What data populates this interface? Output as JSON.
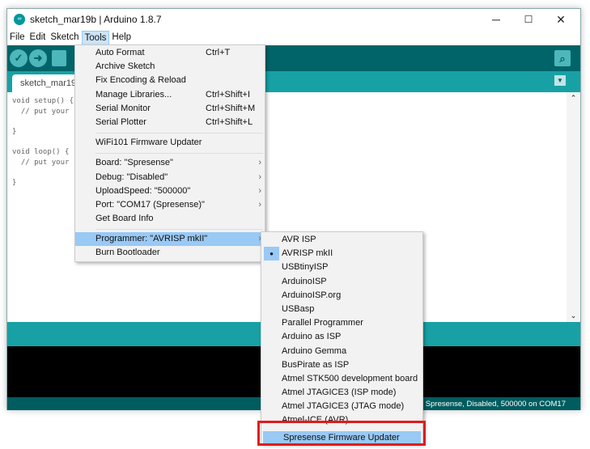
{
  "window": {
    "title": "sketch_mar19b | Arduino 1.8.7",
    "icon": "arduino-logo-icon",
    "controls": {
      "minimize": "─",
      "maximize": "☐",
      "close": "✕"
    }
  },
  "menubar": [
    "File",
    "Edit",
    "Sketch",
    "Tools",
    "Help"
  ],
  "toolbar": {
    "verify": "✓",
    "upload": "➜",
    "new": "new-icon",
    "serial_monitor": "magnifier-icon"
  },
  "tab": {
    "label": "sketch_mar19"
  },
  "editor": {
    "lines": [
      "void setup() {",
      "  // put your",
      "",
      "}",
      "",
      "void loop() {",
      "  // put your",
      "",
      "}"
    ]
  },
  "status": "Spresense, Disabled, 500000 on COM17",
  "tools_menu": {
    "items": [
      {
        "label": "Auto Format",
        "shortcut": "Ctrl+T"
      },
      {
        "label": "Archive Sketch",
        "shortcut": ""
      },
      {
        "label": "Fix Encoding & Reload",
        "shortcut": ""
      },
      {
        "label": "Manage Libraries...",
        "shortcut": "Ctrl+Shift+I"
      },
      {
        "label": "Serial Monitor",
        "shortcut": "Ctrl+Shift+M"
      },
      {
        "label": "Serial Plotter",
        "shortcut": "Ctrl+Shift+L"
      },
      {
        "label": "WiFi101 Firmware Updater",
        "shortcut": ""
      },
      {
        "label": "Board: \"Spresense\"",
        "shortcut": ""
      },
      {
        "label": "Debug: \"Disabled\"",
        "shortcut": ""
      },
      {
        "label": "UploadSpeed: \"500000\"",
        "shortcut": ""
      },
      {
        "label": "Port: \"COM17 (Spresense)\"",
        "shortcut": ""
      },
      {
        "label": "Get Board Info",
        "shortcut": ""
      },
      {
        "label": "Programmer: \"AVRISP mkII\"",
        "shortcut": ""
      },
      {
        "label": "Burn Bootloader",
        "shortcut": ""
      }
    ],
    "submenu_arrow": "›"
  },
  "programmer_submenu": {
    "selected": "AVRISP mkII",
    "items": [
      "AVR ISP",
      "AVRISP mkII",
      "USBtinyISP",
      "ArduinoISP",
      "ArduinoISP.org",
      "USBasp",
      "Parallel Programmer",
      "Arduino as ISP",
      "Arduino Gemma",
      "BusPirate as ISP",
      "Atmel STK500 development board",
      "Atmel JTAGICE3 (ISP mode)",
      "Atmel JTAGICE3 (JTAG mode)",
      "Atmel-ICE (AVR)",
      "Spresense Firmware Updater"
    ],
    "highlighted": "Spresense Firmware Updater"
  },
  "colors": {
    "toolbar": "#006468",
    "tabbar": "#17a1a5",
    "highlight": "#99c9f5",
    "annotation": "#e21b1b"
  }
}
